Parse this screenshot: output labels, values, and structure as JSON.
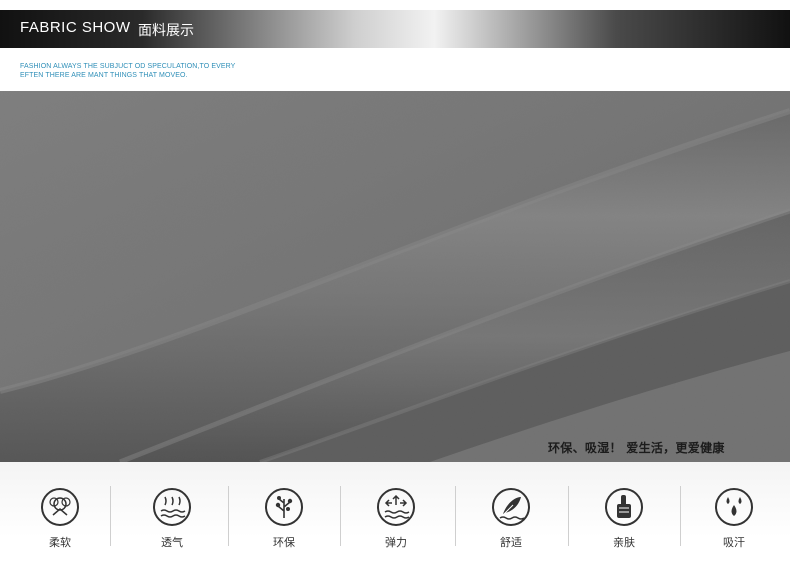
{
  "header": {
    "title": "FABRIC SHOW",
    "subtitle": "面料展示"
  },
  "tagline": {
    "line1": "FASHION ALWAYS THE  SUBJUCT OD SPECULATION,TO EVERY",
    "line2": "EFTEN THERE ARE MANT THINGS THAT MOVEO."
  },
  "fabric_caption": "环保、吸湿！  爱生活，更爱健康",
  "features": [
    {
      "label": "柔软",
      "icon": "cotton-flower-icon"
    },
    {
      "label": "透气",
      "icon": "breathable-waves-icon"
    },
    {
      "label": "环保",
      "icon": "eco-tree-icon"
    },
    {
      "label": "弹力",
      "icon": "stretch-arrows-icon"
    },
    {
      "label": "舒适",
      "icon": "feather-icon"
    },
    {
      "label": "亲肤",
      "icon": "thumbs-up-icon"
    },
    {
      "label": "吸汗",
      "icon": "water-drops-icon"
    }
  ],
  "colors": {
    "tagline": "#2f8fb8",
    "fabric": "#6f6f6f",
    "icon": "#333333"
  }
}
